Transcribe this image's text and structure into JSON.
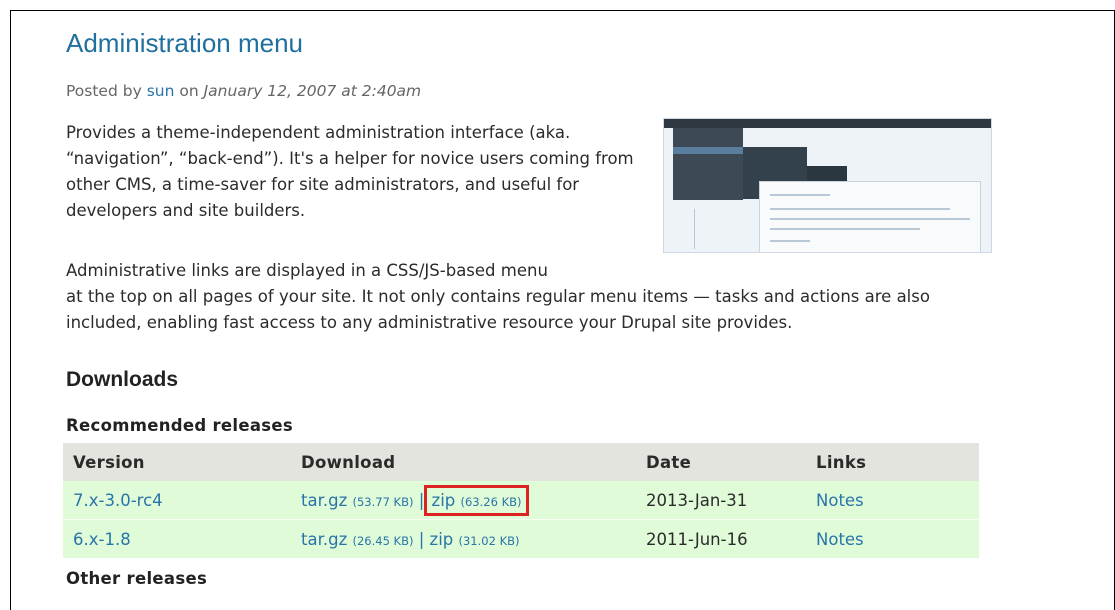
{
  "title": "Administration menu",
  "meta": {
    "prefix": "Posted by",
    "author": "sun",
    "on": "on",
    "date": "January 12, 2007 at 2:40am"
  },
  "intro": "Provides a theme-independent administration interface (aka. “navigation”, “back-end”). It's a helper for novice users coming from other CMS, a time-saver for site administrators, and useful for developers and site builders.",
  "para2_first": "Administrative links are displayed in a CSS/JS-based menu",
  "para2_rest": "at the top on all pages of your site. It not only contains regular menu items — tasks and actions are also included, enabling fast access to any administrative resource your Drupal site provides.",
  "downloads_heading": "Downloads",
  "recommended_heading": "Recommended releases",
  "other_heading": "Other releases",
  "table": {
    "headers": {
      "version": "Version",
      "download": "Download",
      "date": "Date",
      "links": "Links"
    },
    "rows": [
      {
        "version": "7.x-3.0-rc4",
        "targz": "tar.gz",
        "targz_size": "(53.77 KB)",
        "sep": "|",
        "zip": "zip",
        "zip_size": "(63.26 KB)",
        "date": "2013-Jan-31",
        "notes": "Notes"
      },
      {
        "version": "6.x-1.8",
        "targz": "tar.gz",
        "targz_size": "(26.45 KB)",
        "sep": "|",
        "zip": "zip",
        "zip_size": "(31.02 KB)",
        "date": "2011-Jun-16",
        "notes": "Notes"
      }
    ]
  },
  "colors": {
    "link": "#2a74a8",
    "title": "#1f6f9f",
    "row_bg": "#dffbd8",
    "header_bg": "#e4e4de",
    "highlight_box": "#dd2222"
  }
}
